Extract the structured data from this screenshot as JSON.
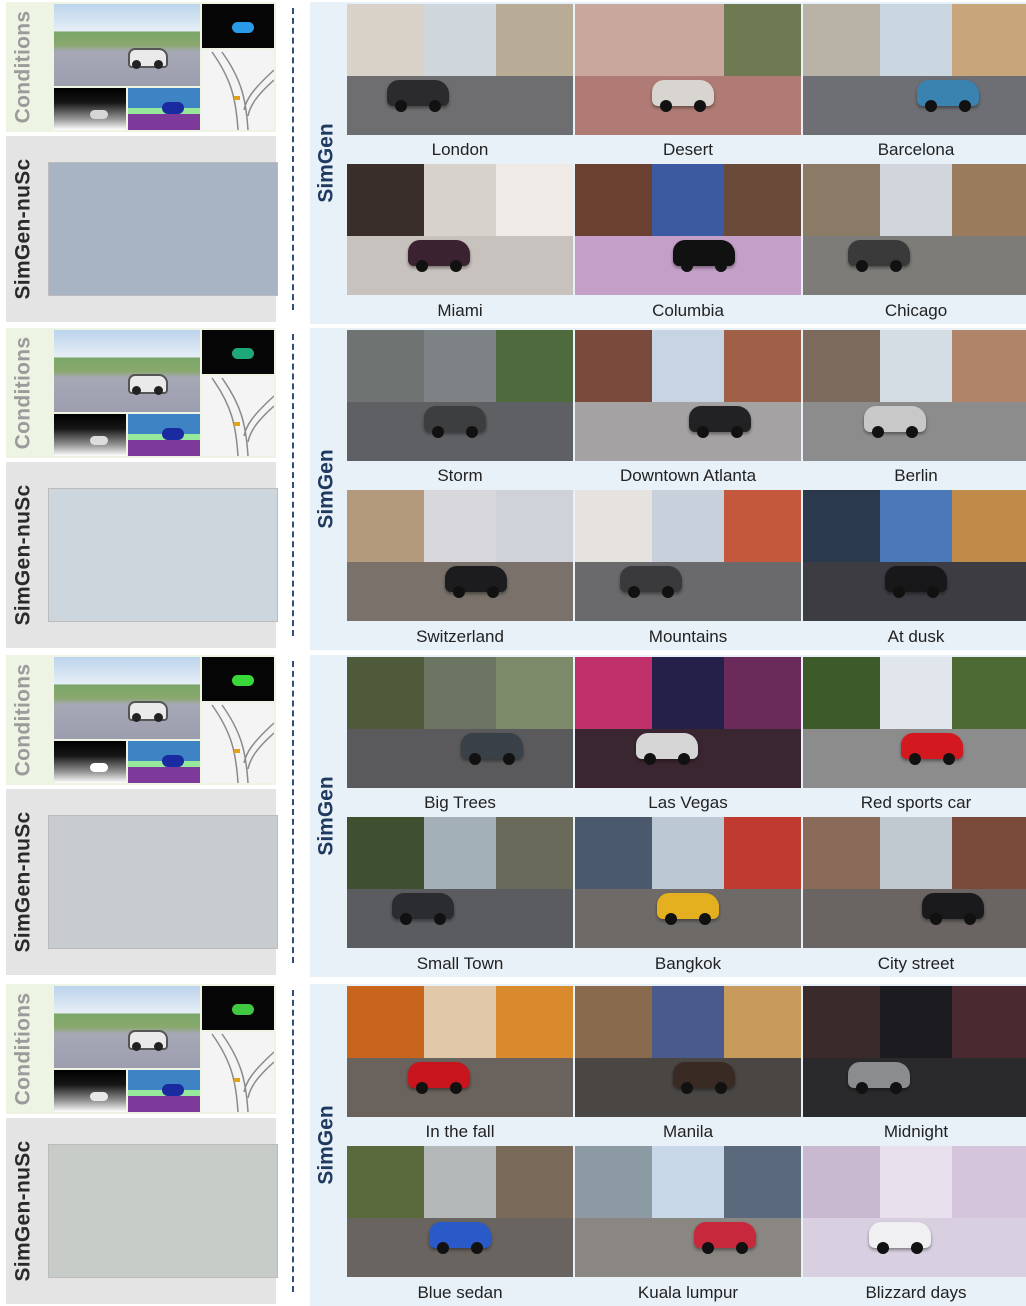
{
  "labels": {
    "conditions": "Conditions",
    "nusc": "SimGen-nuSc",
    "simgen": "SimGen"
  },
  "colors": {
    "simgen_label": "#1f3a60",
    "conditions_label": "#9b9b9b",
    "simgen_panel": "#e8f1f8",
    "conditions_panel": "#eef4e4",
    "nusc_panel": "#e4e4e4",
    "divider": "#2f4f7a"
  },
  "groups": [
    {
      "captions": [
        "London",
        "Desert",
        "Barcelona",
        "Miami",
        "Columbia",
        "Chicago"
      ],
      "scenes": [
        {
          "sky": "#cfd6dc",
          "ground": "#6e6e70",
          "left": "#d8d2c8",
          "right": "#b9ac96",
          "car": "#2b2b2e"
        },
        {
          "sky": "#c9a79c",
          "ground": "#b07b74",
          "left": "#c9a79c",
          "right": "#6f7a52",
          "car": "#d8d4d0"
        },
        {
          "sky": "#cad7e0",
          "ground": "#6d6f74",
          "left": "#b9b2a6",
          "right": "#c9a57c",
          "car": "#3a82b0"
        },
        {
          "sky": "#d8d2cc",
          "ground": "#c8c2be",
          "left": "#3a2e2a",
          "right": "#efeae6",
          "car": "#3a2230"
        },
        {
          "sky": "#3c5aa0",
          "ground": "#c4a0c8",
          "left": "#6a4030",
          "right": "#6a4a38",
          "car": "#111111"
        },
        {
          "sky": "#d0d6dc",
          "ground": "#7d7c78",
          "left": "#8a7a66",
          "right": "#9a7c5c",
          "car": "#3a3a3a"
        }
      ],
      "nusc": {
        "sky": "#a8b4c4",
        "ground": "#6c6a68",
        "left": "#4a4a4c",
        "right": "#8c8c90",
        "car": "#1e2224"
      },
      "sim_car": "#eaeaea",
      "seg_color": "#2a9ae8",
      "depth_car": "#d6d6d6"
    },
    {
      "captions": [
        "Storm",
        "Downtown Atlanta",
        "Berlin",
        "Switzerland",
        "Mountains",
        "At dusk"
      ],
      "scenes": [
        {
          "sky": "#7d8284",
          "ground": "#5e6064",
          "left": "#6f7472",
          "right": "#4f6a3c",
          "car": "#3c3e40"
        },
        {
          "sky": "#c6d4e4",
          "ground": "#a4a2a2",
          "left": "#7a4a3c",
          "right": "#a06048",
          "car": "#222224"
        },
        {
          "sky": "#d4dce4",
          "ground": "#8c8c8c",
          "left": "#7c6a5c",
          "right": "#b08468",
          "car": "#c8c8c8"
        },
        {
          "sky": "#d8d8dc",
          "ground": "#7a726a",
          "left": "#b49a7c",
          "right": "#cfd2d8",
          "car": "#1c1c1e"
        },
        {
          "sky": "#c8d0dc",
          "ground": "#6a6a6c",
          "left": "#e6e2e0",
          "right": "#c4583c",
          "car": "#3a3a3c"
        },
        {
          "sky": "#4a78b8",
          "ground": "#3c3c42",
          "left": "#2a3a4c",
          "right": "#c08a48",
          "car": "#18181a"
        }
      ],
      "nusc": {
        "sky": "#cdd6dc",
        "ground": "#6a6a6a",
        "left": "#3e4a3a",
        "right": "#6a7a80",
        "car": "#eeeeee"
      },
      "sim_car": "#eaeaea",
      "seg_color": "#1ea87a",
      "depth_car": "#dcdcdc"
    },
    {
      "captions": [
        "Big Trees",
        "Las Vegas",
        "Red sports car",
        "Small Town",
        "Bangkok",
        "City street"
      ],
      "scenes": [
        {
          "sky": "#6c7462",
          "ground": "#5a5a5c",
          "left": "#4e5a3a",
          "right": "#7c8a6a",
          "car": "#3a4048"
        },
        {
          "sky": "#24204a",
          "ground": "#3a2630",
          "left": "#c0306a",
          "right": "#6a2a5a",
          "car": "#d6d6d6"
        },
        {
          "sky": "#e0e6ec",
          "ground": "#8c8c8c",
          "left": "#3c5a2a",
          "right": "#4e6a34",
          "car": "#d41820"
        },
        {
          "sky": "#a4b0b8",
          "ground": "#5a5c60",
          "left": "#3e5030",
          "right": "#6a6a5a",
          "car": "#2a2c30"
        },
        {
          "sky": "#bcc8d4",
          "ground": "#6e6a68",
          "left": "#4a5a6c",
          "right": "#c03a30",
          "car": "#e4b020"
        },
        {
          "sky": "#c0c8d0",
          "ground": "#6a6462",
          "left": "#8a6a58",
          "right": "#7a4a3a",
          "car": "#1a1a1c"
        }
      ],
      "nusc": {
        "sky": "#c8ccd0",
        "ground": "#7a7876",
        "left": "#9a9690",
        "right": "#5a6a4c",
        "car": "#e8e8e8"
      },
      "sim_car": "#eaeaea",
      "seg_color": "#38d838",
      "depth_car": "#ffffff"
    },
    {
      "captions": [
        "In the fall",
        "Manila",
        "Midnight",
        "Blue sedan",
        "Kuala lumpur",
        "Blizzard days"
      ],
      "scenes": [
        {
          "sky": "#e0c8a8",
          "ground": "#6a625c",
          "left": "#c8641c",
          "right": "#d88a2c",
          "car": "#c8141c"
        },
        {
          "sky": "#4a5a8c",
          "ground": "#4a4644",
          "left": "#8a6a4c",
          "right": "#c89a5c",
          "car": "#3a2a24"
        },
        {
          "sky": "#1c1c20",
          "ground": "#2a2a2c",
          "left": "#3a2a2c",
          "right": "#4a2a30",
          "car": "#8a8c8e"
        },
        {
          "sky": "#b4b8b8",
          "ground": "#6a6460",
          "left": "#5a6a3c",
          "right": "#7a6a5a",
          "car": "#2a5ac8"
        },
        {
          "sky": "#c8d8e8",
          "ground": "#8a8682",
          "left": "#8c9aa4",
          "right": "#5a6a7c",
          "car": "#c8283c"
        },
        {
          "sky": "#e8e0ec",
          "ground": "#d8d0e0",
          "left": "#c8b8d0",
          "right": "#d4c4dc",
          "car": "#f0f0f2"
        }
      ],
      "nusc": {
        "sky": "#c8ccc8",
        "ground": "#6a6a68",
        "left": "#4a5a3c",
        "right": "#8a8270",
        "car": "#e8b020"
      },
      "sim_car": "#eaeaea",
      "seg_color": "#40c840",
      "depth_car": "#e8e8e8"
    }
  ]
}
